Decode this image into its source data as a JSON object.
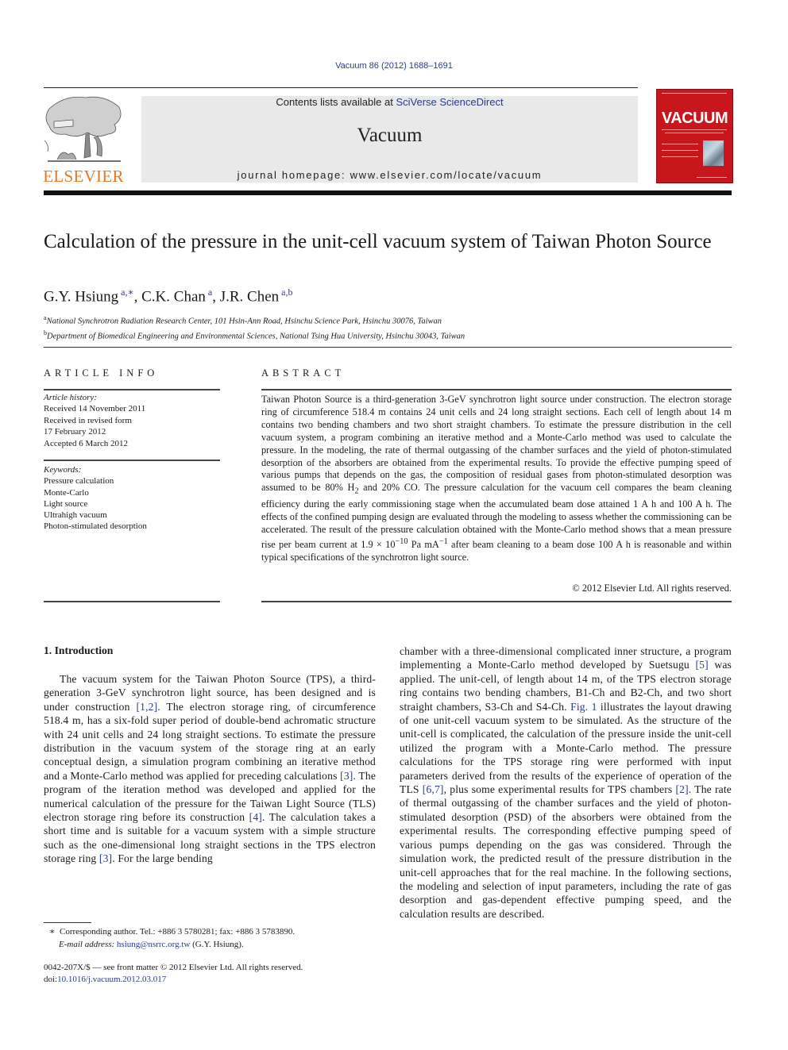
{
  "header": {
    "citation": "Vacuum 86 (2012) 1688–1691",
    "contents_prefix": "Contents lists available at ",
    "contents_link": "SciVerse ScienceDirect",
    "journal_name": "Vacuum",
    "homepage": "journal homepage: www.elsevier.com/locate/vacuum",
    "publisher_logo_text": "ELSEVIER",
    "cover_title": "VACUUM",
    "colors": {
      "publisher_orange": "#e87722",
      "cover_red": "#c8161d",
      "link_blue": "#2a3a8c",
      "masthead_gray": "#e9e9e9"
    }
  },
  "article": {
    "title": "Calculation of the pressure in the unit-cell vacuum system of Taiwan Photon Source",
    "authors": [
      {
        "name": "G.Y. Hsiung",
        "sup": "a,∗"
      },
      {
        "name": "C.K. Chan",
        "sup": "a"
      },
      {
        "name": "J.R. Chen",
        "sup": "a,b"
      }
    ],
    "affiliations": [
      {
        "mark": "a",
        "text": "National Synchrotron Radiation Research Center, 101 Hsin-Ann Road, Hsinchu Science Park, Hsinchu 30076, Taiwan"
      },
      {
        "mark": "b",
        "text": "Department of Biomedical Engineering and Environmental Sciences, National Tsing Hua University, Hsinchu 30043, Taiwan"
      }
    ]
  },
  "article_info": {
    "heading": "ARTICLE INFO",
    "history_label": "Article history:",
    "history": [
      "Received 14 November 2011",
      "Received in revised form",
      "17 February 2012",
      "Accepted 6 March 2012"
    ],
    "keywords_label": "Keywords:",
    "keywords": [
      "Pressure calculation",
      "Monte-Carlo",
      "Light source",
      "Ultrahigh vacuum",
      "Photon-stimulated desorption"
    ]
  },
  "abstract": {
    "heading": "ABSTRACT",
    "part1": "Taiwan Photon Source is a third-generation 3-GeV synchrotron light source under construction. The electron storage ring of circumference 518.4 m contains 24 unit cells and 24 long straight sections. Each cell of length about 14 m contains two bending chambers and two short straight chambers. To estimate the pressure distribution in the cell vacuum system, a program combining an iterative method and a Monte-Carlo method was used to calculate the pressure. In the modeling, the rate of thermal outgassing of the chamber surfaces and the yield of photon-stimulated desorption of the absorbers are obtained from the experimental results. To provide the effective pumping speed of various pumps that depends on the gas, the composition of residual gases from photon-stimulated desorption was assumed to be 80% H",
    "h2_sub": "2",
    "part2": " and 20% CO. The pressure calculation for the vacuum cell compares the beam cleaning efficiency during the early commissioning stage when the accumulated beam dose attained 1 A h and 100 A h. The effects of the confined pumping design are evaluated through the modeling to assess whether the commissioning can be accelerated. The result of the pressure calculation obtained with the Monte-Carlo method shows that a mean pressure rise per beam current at 1.9 × 10",
    "exp1": "−10",
    "part3": " Pa mA",
    "exp2": "−1",
    "part4": " after beam cleaning to a beam dose 100 A h is reasonable and within typical specifications of the synchrotron light source.",
    "copyright": "© 2012 Elsevier Ltd. All rights reserved."
  },
  "introduction": {
    "heading": "1.  Introduction",
    "col1": [
      {
        "t": "The vacuum system for the Taiwan Photon Source (TPS), a third-generation 3-GeV synchrotron light source, has been designed and is under construction "
      },
      {
        "ref": "[1,2]"
      },
      {
        "t": ". The electron storage ring, of circumference 518.4 m, has a six-fold super period of double-bend achromatic structure with 24 unit cells and 24 long straight sections. To estimate the pressure distribution in the vacuum system of the storage ring at an early conceptual design, a simulation program combining an iterative method and a Monte-Carlo method was applied for preceding calculations "
      },
      {
        "ref": "[3]"
      },
      {
        "t": ". The program of the iteration method was developed and applied for the numerical calculation of the pressure for the Taiwan Light Source (TLS) electron storage ring before its construction "
      },
      {
        "ref": "[4]"
      },
      {
        "t": ". The calculation takes a short time and is suitable for a vacuum system with a simple structure such as the one-dimensional long straight sections in the TPS electron storage ring "
      },
      {
        "ref": "[3]"
      },
      {
        "t": ". For the large bending"
      }
    ],
    "col2": [
      {
        "t": "chamber with a three-dimensional complicated inner structure, a program implementing a Monte-Carlo method developed by Suetsugu "
      },
      {
        "ref": "[5]"
      },
      {
        "t": " was applied. The unit-cell, of length about 14 m, of the TPS electron storage ring contains two bending chambers, B1-Ch and B2-Ch, and two short straight chambers, S3-Ch and S4-Ch. "
      },
      {
        "ref": "Fig. 1"
      },
      {
        "t": " illustrates the layout drawing of one unit-cell vacuum system to be simulated. As the structure of the unit-cell is complicated, the calculation of the pressure inside the unit-cell utilized the program with a Monte-Carlo method. The pressure calculations for the TPS storage ring were performed with input parameters derived from the results of the experience of operation of the TLS "
      },
      {
        "ref": "[6,7]"
      },
      {
        "t": ", plus some experimental results for TPS chambers "
      },
      {
        "ref": "[2]"
      },
      {
        "t": ". The rate of thermal outgassing of the chamber surfaces and the yield of photon-stimulated desorption (PSD) of the absorbers were obtained from the experimental results. The corresponding effective pumping speed of various pumps depending on the gas was considered. Through the simulation work, the predicted result of the pressure distribution in the unit-cell approaches that for the real machine. In the following sections, the modeling and selection of input parameters, including the rate of gas desorption and gas-dependent effective pumping speed, and the calculation results are described."
      }
    ]
  },
  "footnotes": {
    "star": "∗",
    "corresponding": "Corresponding author. Tel.: +886 3 5780281; fax: +886 3 5783890.",
    "email_label": "E-mail address:",
    "email": "hsiung@nsrrc.org.tw",
    "email_suffix": " (G.Y. Hsiung).",
    "front_matter": "0042-207X/$ — see front matter © 2012 Elsevier Ltd. All rights reserved.",
    "doi_prefix": "doi:",
    "doi": "10.1016/j.vacuum.2012.03.017"
  }
}
